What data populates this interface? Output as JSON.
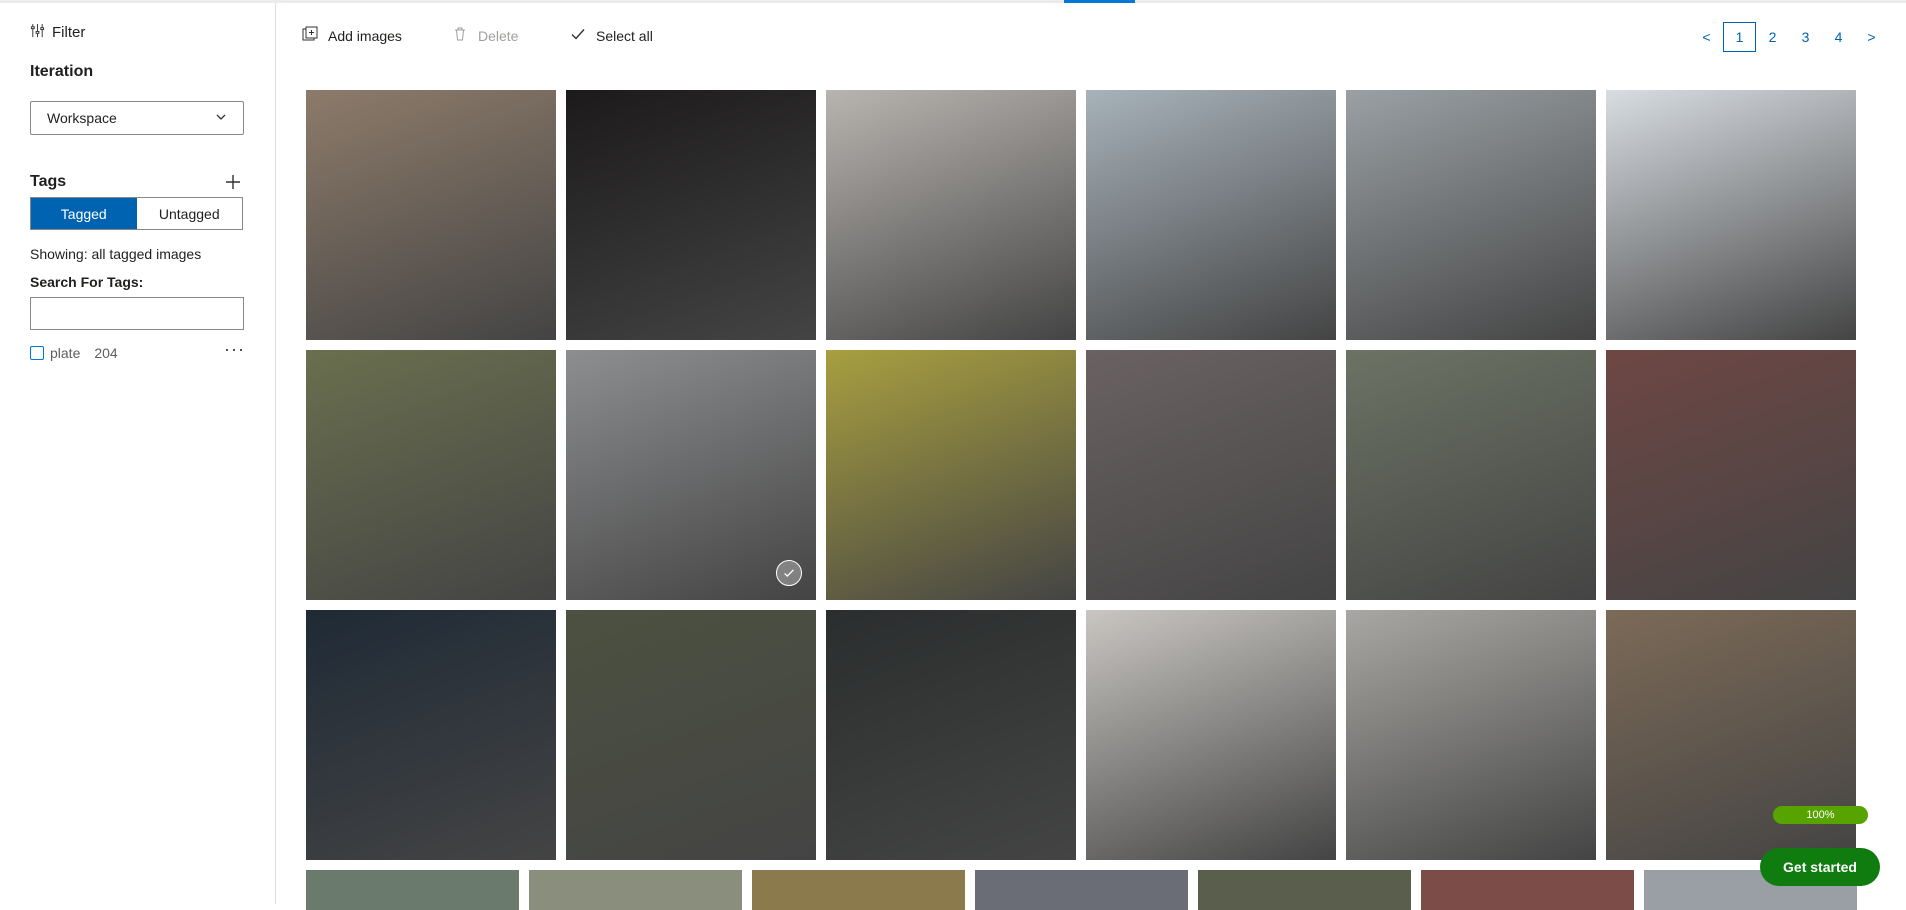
{
  "sidebar": {
    "filter_label": "Filter",
    "iteration_label": "Iteration",
    "iteration_value": "Workspace",
    "tags_label": "Tags",
    "toggle": {
      "tagged": "Tagged",
      "untagged": "Untagged"
    },
    "showing": "Showing: all tagged images",
    "search_label": "Search For Tags:",
    "search_value": "",
    "tags": [
      {
        "name": "plate",
        "count": "204"
      }
    ]
  },
  "toolbar": {
    "add_images": "Add images",
    "delete": "Delete",
    "select_all": "Select all"
  },
  "pager": {
    "prev": "<",
    "pages": [
      "1",
      "2",
      "3",
      "4"
    ],
    "next": ">"
  },
  "images": [
    {
      "color": "#8d7b6a"
    },
    {
      "color": "#1c1a1a"
    },
    {
      "color": "#b8b4b0"
    },
    {
      "color": "#a7b2ba"
    },
    {
      "color": "#9aa0a4"
    },
    {
      "color": "#d8dde2"
    },
    {
      "color": "#6a6f4e"
    },
    {
      "color": "#8d8e90"
    },
    {
      "color": "#a89f3f"
    },
    {
      "color": "#6a6262"
    },
    {
      "color": "#6c7364"
    },
    {
      "color": "#6e4744"
    },
    {
      "color": "#1f2a36"
    },
    {
      "color": "#4c5140"
    },
    {
      "color": "#2b2e2e"
    },
    {
      "color": "#c9c6c2"
    },
    {
      "color": "#a8a7a3"
    },
    {
      "color": "#7c6a57"
    }
  ],
  "selected_index": 7,
  "progress": "100%",
  "get_started": "Get started"
}
